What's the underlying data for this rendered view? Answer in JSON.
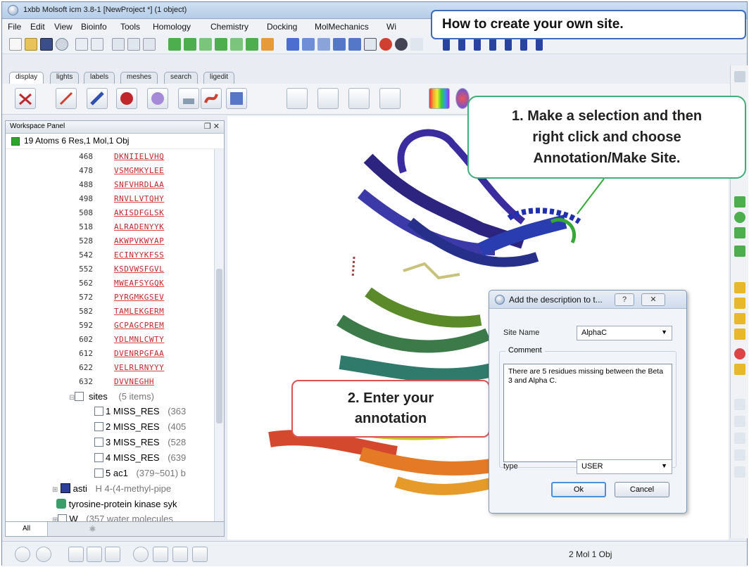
{
  "window": {
    "title": "1xbb Molsoft icm 3.8-1  [NewProject *] (1 object)"
  },
  "menu": [
    {
      "label": "File"
    },
    {
      "label": "Edit"
    },
    {
      "label": "View"
    },
    {
      "label": "Bioinfo"
    },
    {
      "label": "Tools"
    },
    {
      "label": "Homology"
    },
    {
      "label": "Chemistry"
    },
    {
      "label": "Docking"
    },
    {
      "label": "MolMechanics"
    },
    {
      "label": "Wi"
    }
  ],
  "tabs": [
    "display",
    "lights",
    "labels",
    "meshes",
    "search",
    "ligedit"
  ],
  "panel": {
    "title": "Workspace Panel",
    "controls": "❒ ✕",
    "object_line": "19 Atoms 6 Res,1 Mol,1 Obj",
    "sequence": [
      {
        "num": "468",
        "res": "DKNIIELVHQ"
      },
      {
        "num": "478",
        "res": "VSMGMKYLEE"
      },
      {
        "num": "488",
        "res": "SNFVHRDLAA"
      },
      {
        "num": "498",
        "res": "RNVLLVTQHY"
      },
      {
        "num": "508",
        "res": "AKISDFGLSK"
      },
      {
        "num": "518",
        "res": "ALRADENYYK"
      },
      {
        "num": "528",
        "res": "AKWPVKWYAP"
      },
      {
        "num": "542",
        "res": "ECINYYKFSS"
      },
      {
        "num": "552",
        "res": "KSDVWSFGVL"
      },
      {
        "num": "562",
        "res": "MWEAFSYGQK"
      },
      {
        "num": "572",
        "res": "PYRGMKGSEV"
      },
      {
        "num": "582",
        "res": "TAMLEKGERM"
      },
      {
        "num": "592",
        "res": "GCPAGCPREM"
      },
      {
        "num": "602",
        "res": "YDLMNLCWTY"
      },
      {
        "num": "612",
        "res": "DVENRPGFAA"
      },
      {
        "num": "622",
        "res": "VELRLRNYYY"
      },
      {
        "num": "632",
        "res": "DVVNEGHH"
      }
    ],
    "sites_label": "sites",
    "sites_count": "(5 items)",
    "sites": [
      {
        "name": "1 MISS_RES",
        "detail": "(363"
      },
      {
        "name": "2 MISS_RES",
        "detail": "(405"
      },
      {
        "name": "3 MISS_RES",
        "detail": "(528"
      },
      {
        "name": "4 MISS_RES",
        "detail": "(639"
      },
      {
        "name": "5 ac1",
        "detail": "(379~501) b"
      }
    ],
    "asti_name": "asti",
    "asti_detail": "H  4-(4-methyl-pipe",
    "kinase_name": "tyrosine-protein kinase syk",
    "water_name": "W",
    "water_detail": "(357 water molecules",
    "bottom_tab": "All"
  },
  "status": {
    "text": "2 Mol 1 Obj"
  },
  "callouts": {
    "top": "How to create your own site.",
    "step1": "1. Make a selection and then\nright click and choose\nAnnotation/Make Site.",
    "step2": "2. Enter your\nannotation"
  },
  "dialog": {
    "title": "Add the description to t...",
    "help": "?",
    "close": "✕",
    "site_name_label": "Site Name",
    "site_name_value": "AlphaC",
    "comment_label": "Comment",
    "comment_text": "There are 5 residues missing between the Beta 3 and Alpha C.",
    "type_label": "type",
    "type_value": "USER",
    "ok_label": "Ok",
    "cancel_label": "Cancel"
  },
  "colors": {
    "callout_top_border": "#3d6db8",
    "callout_step1_border": "#3fae7b",
    "callout_step2_border": "#e05252",
    "sequence_text": "#c0272d"
  }
}
